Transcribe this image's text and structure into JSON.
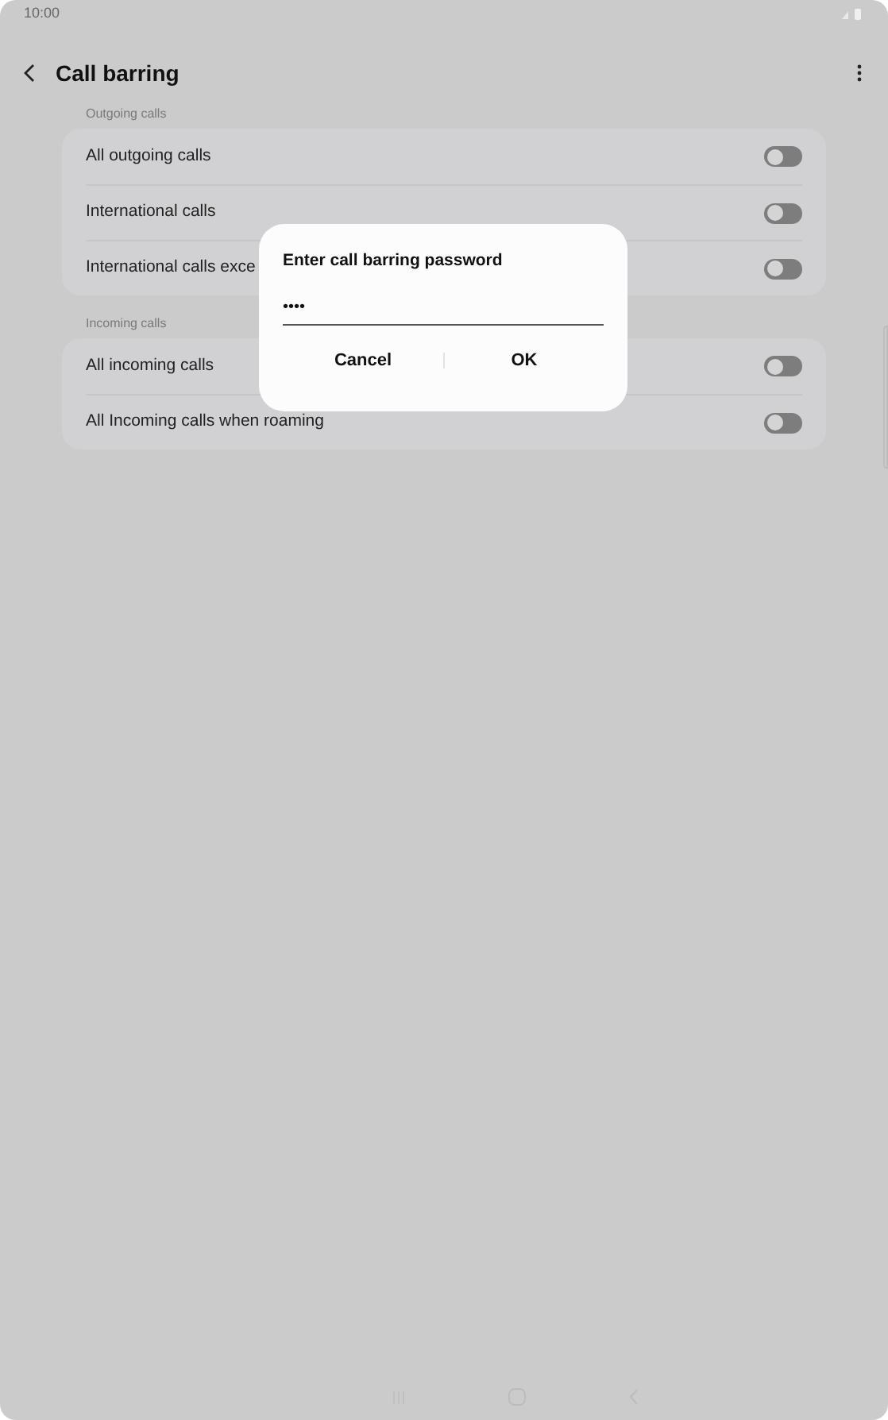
{
  "status_bar": {
    "time": "10:00"
  },
  "header": {
    "title": "Call barring"
  },
  "sections": [
    {
      "label": "Outgoing calls",
      "rows": [
        {
          "label": "All outgoing calls",
          "on": false
        },
        {
          "label": "International calls",
          "on": false
        },
        {
          "label": "International calls exce",
          "on": false
        }
      ]
    },
    {
      "label": "Incoming calls",
      "rows": [
        {
          "label": "All incoming calls",
          "on": false
        },
        {
          "label": "All Incoming calls when roaming",
          "on": false
        }
      ]
    }
  ],
  "dialog": {
    "title": "Enter call barring password",
    "value": "••••",
    "buttons": [
      "Cancel",
      "OK"
    ]
  }
}
